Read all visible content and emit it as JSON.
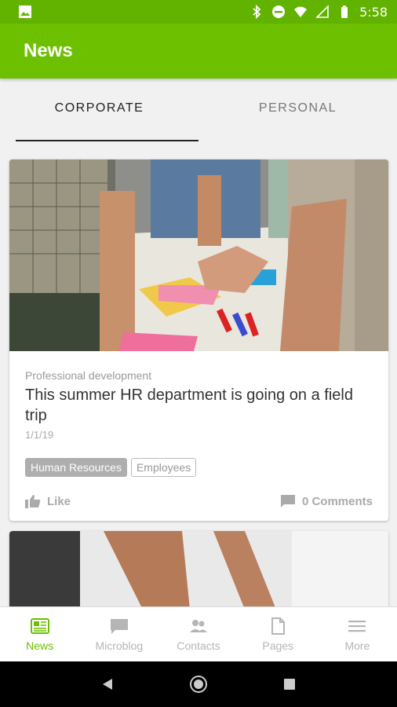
{
  "status_bar": {
    "time": "5:58",
    "icons": [
      "image-icon",
      "bluetooth-icon",
      "do-not-disturb-icon",
      "wifi-icon",
      "signal-icon",
      "battery-icon"
    ]
  },
  "app_bar": {
    "title": "News"
  },
  "tabs": [
    {
      "label": "CORPORATE",
      "active": true
    },
    {
      "label": "PERSONAL",
      "active": false
    }
  ],
  "articles": [
    {
      "category": "Professional development",
      "title": "This summer HR department is going on a field trip",
      "date": "1/1/19",
      "tags": [
        "Human Resources",
        "Employees"
      ],
      "like_label": "Like",
      "comments_label": "0 Comments"
    }
  ],
  "bottom_nav": [
    {
      "label": "News",
      "icon": "news-icon",
      "active": true
    },
    {
      "label": "Microblog",
      "icon": "microblog-icon",
      "active": false
    },
    {
      "label": "Contacts",
      "icon": "contacts-icon",
      "active": false
    },
    {
      "label": "Pages",
      "icon": "pages-icon",
      "active": false
    },
    {
      "label": "More",
      "icon": "menu-icon",
      "active": false
    }
  ],
  "colors": {
    "status_bar": "#62b300",
    "app_bar": "#6cc000",
    "accent": "#6cc000"
  }
}
